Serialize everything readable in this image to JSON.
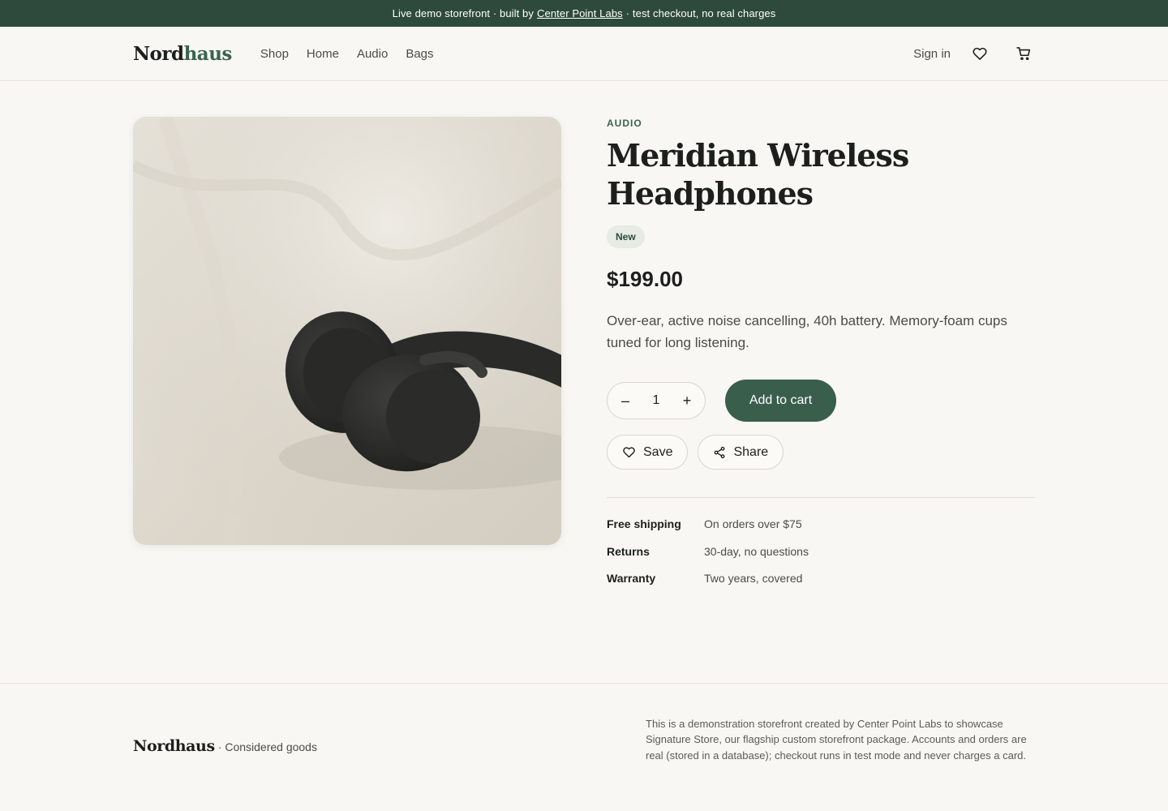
{
  "banner": {
    "prefix": "Live demo storefront · built by",
    "link": "Center Point Labs",
    "suffix": "· test checkout, no real charges"
  },
  "header": {
    "logo_part1": "Nord",
    "logo_part2": "haus",
    "nav": [
      "Shop",
      "Home",
      "Audio",
      "Bags"
    ],
    "sign_in": "Sign in",
    "wishlist_icon": "heart-icon",
    "cart_icon": "cart-icon"
  },
  "product": {
    "image_alt": "Black over-ear headphones on linen fabric",
    "category": "AUDIO",
    "title": "Meridian Wireless Headphones",
    "badge": "New",
    "price": "$199.00",
    "description": "Over-ear, active noise cancelling, 40h battery. Memory-foam cups tuned for long listening.",
    "quantity": "1",
    "qty_minus": "–",
    "qty_plus": "+",
    "add_to_cart": "Add to cart",
    "save": "Save",
    "share": "Share",
    "specs": [
      {
        "label": "Free shipping",
        "value": "On orders over $75"
      },
      {
        "label": "Returns",
        "value": "30-day, no questions"
      },
      {
        "label": "Warranty",
        "value": "Two years, covered"
      }
    ]
  },
  "footer": {
    "logo": "Nordhaus",
    "tagline": "· Considered goods",
    "note": "This is a demonstration storefront created by Center Point Labs to showcase Signature Store, our flagship custom storefront package. Accounts and orders are real (stored in a database); checkout runs in test mode and never charges a card."
  },
  "colors": {
    "brand_green": "#2d4a3d",
    "accent_green": "#3a6350",
    "button_green": "#3a5e4c",
    "background": "#f8f7f3"
  }
}
